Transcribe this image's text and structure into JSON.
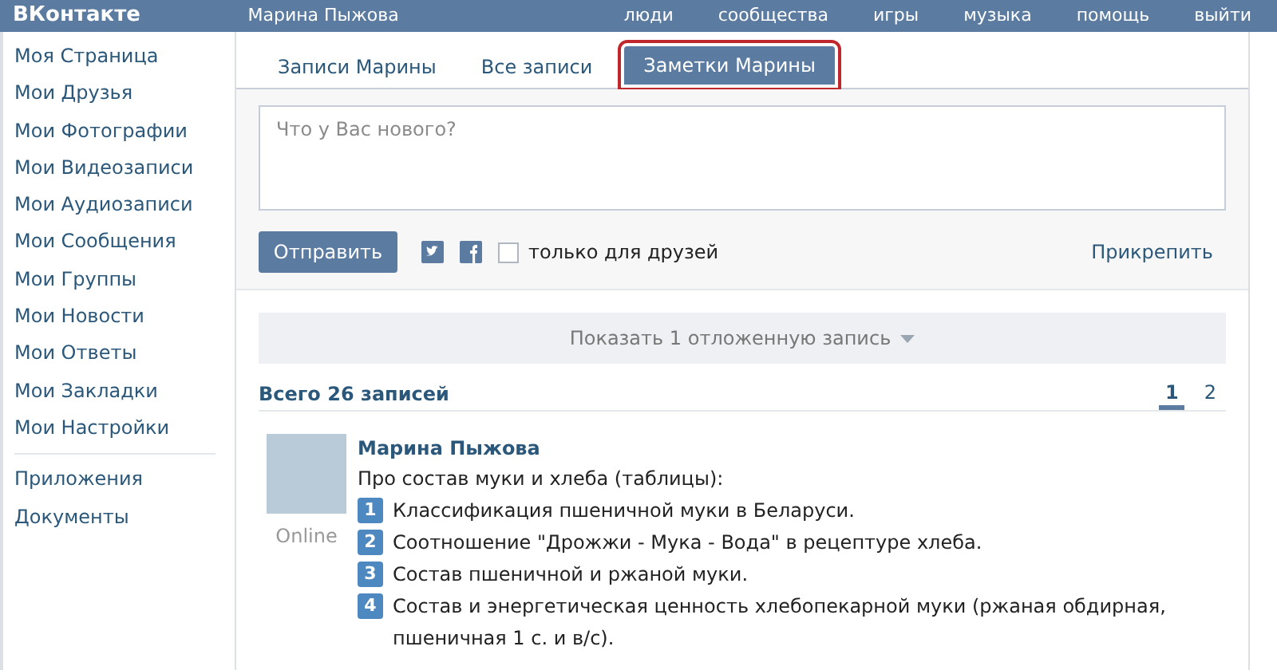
{
  "header": {
    "logo": "ВКонтакте",
    "user": "Марина Пыжова",
    "nav": [
      "люди",
      "сообщества",
      "игры",
      "музыка",
      "помощь",
      "выйти"
    ]
  },
  "sidebar": {
    "groups": [
      [
        "Моя Страница",
        "Мои Друзья",
        "Мои Фотографии",
        "Мои Видеозаписи",
        "Мои Аудиозаписи",
        "Мои Сообщения",
        "Мои Группы",
        "Мои Новости",
        "Мои Ответы",
        "Мои Закладки",
        "Мои Настройки"
      ],
      [
        "Приложения",
        "Документы"
      ]
    ]
  },
  "tabs": [
    {
      "label": "Записи Марины",
      "selected": false
    },
    {
      "label": "Все записи",
      "selected": false
    },
    {
      "label": "Заметки Марины",
      "selected": true
    }
  ],
  "composer": {
    "placeholder": "Что у Вас нового?",
    "send": "Отправить",
    "friends_only": {
      "label": "только для друзей",
      "checked": false
    },
    "attach": "Прикрепить"
  },
  "postponed": "Показать 1 отложенную запись",
  "count": "Всего 26 записей",
  "pages": [
    {
      "label": "1",
      "selected": true
    },
    {
      "label": "2",
      "selected": false
    }
  ],
  "post": {
    "author": "Марина Пыжова",
    "status": "Online",
    "intro": "Про состав муки и хлеба (таблицы):",
    "items": [
      {
        "num": "1",
        "text": "Классификация пшеничной муки в Беларуси."
      },
      {
        "num": "2",
        "text": "Соотношение \"Дрожжи - Мука - Вода\" в рецептуре хлеба."
      },
      {
        "num": "3",
        "text": "Состав пшеничной и ржаной муки."
      },
      {
        "num": "4",
        "text": "Состав и энергетическая ценность хлебопекарной муки (ржаная обдирная, пшеничная 1 с. и в/с)."
      }
    ]
  }
}
